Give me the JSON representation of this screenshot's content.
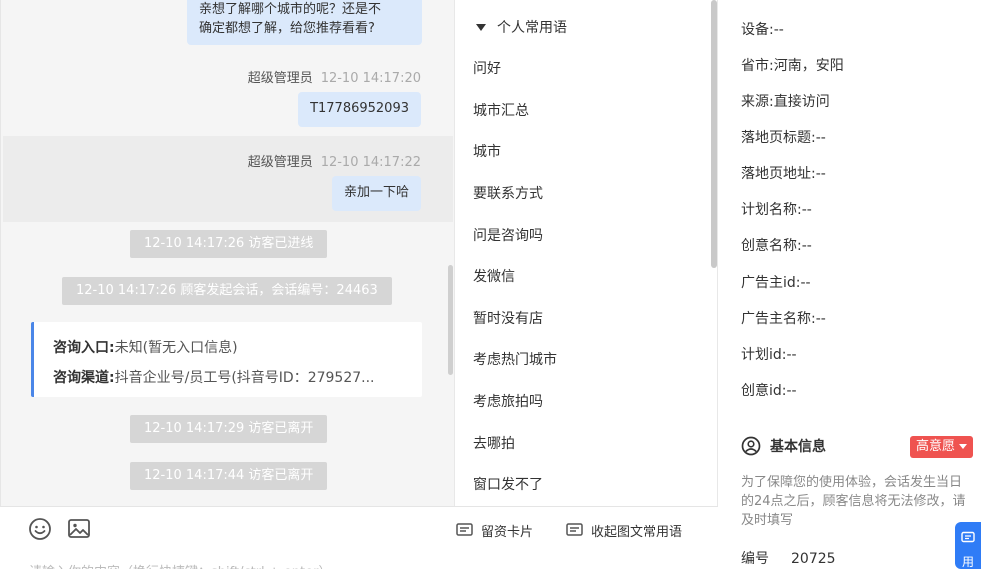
{
  "chat": {
    "msg1_line1": "亲想了解哪个城市的呢？还是不",
    "msg1_line2": "确定都想了解，给您推荐看看?",
    "msg2_sender": "超级管理员",
    "msg2_time": "12-10 14:17:20",
    "msg2_text": "T17786952093",
    "msg3_sender": "超级管理员",
    "msg3_time": "12-10 14:17:22",
    "msg3_text": "亲加一下哈",
    "sys1": "12-10 14:17:26 访客已进线",
    "sys2": "12-10 14:17:26 顾客发起会话，会话编号：24463",
    "entry_label": "咨询入口:",
    "entry_value": "未知(暂无入口信息)",
    "channel_label": "咨询渠道:",
    "channel_value": "抖音企业号/员工号(抖音号ID：279527...",
    "sys3": "12-10 14:17:29 访客已离开",
    "sys4": "12-10 14:17:44 访客已离开"
  },
  "toolbar": {
    "emoji_icon": "smile-icon",
    "image_icon": "image-icon",
    "lead_card": "留资卡片",
    "collapse_phrases": "收起图文常用语",
    "input_placeholder": "请输入你的内容（换行快捷键：shift/ctrl + enter）"
  },
  "phrases": {
    "group_title": "个人常用语",
    "items": [
      "问好",
      "城市汇总",
      "城市",
      "要联系方式",
      "问是咨询吗",
      "发微信",
      "暂时没有店",
      "考虑热门城市",
      "考虑旅拍吗",
      "去哪拍",
      "窗口发不了"
    ]
  },
  "info": {
    "fields": [
      {
        "label": "设备:",
        "value": "--"
      },
      {
        "label": "省市:",
        "value": "河南，安阳"
      },
      {
        "label": "来源:",
        "value": "直接访问"
      },
      {
        "label": "落地页标题:",
        "value": "--"
      },
      {
        "label": "落地页地址:",
        "value": "--"
      },
      {
        "label": "计划名称:",
        "value": "--"
      },
      {
        "label": "创意名称:",
        "value": "--"
      },
      {
        "label": "广告主id:",
        "value": "--"
      },
      {
        "label": "广告主名称:",
        "value": "--"
      },
      {
        "label": "计划id:",
        "value": "--"
      },
      {
        "label": "创意id:",
        "value": "--"
      }
    ],
    "basic_title": "基本信息",
    "intent_badge": "高意愿",
    "note": "为了保障您的使用体验，会话发生当日的24点之后，顾客信息将无法修改，请及时填写",
    "id_label": "编号",
    "id_value": "20725",
    "float_label": "用"
  },
  "colors": {
    "accent": "#4a86e8",
    "bubble": "#dbe9fb",
    "badge": "#ef5350",
    "float_button": "#2f7cf6"
  }
}
